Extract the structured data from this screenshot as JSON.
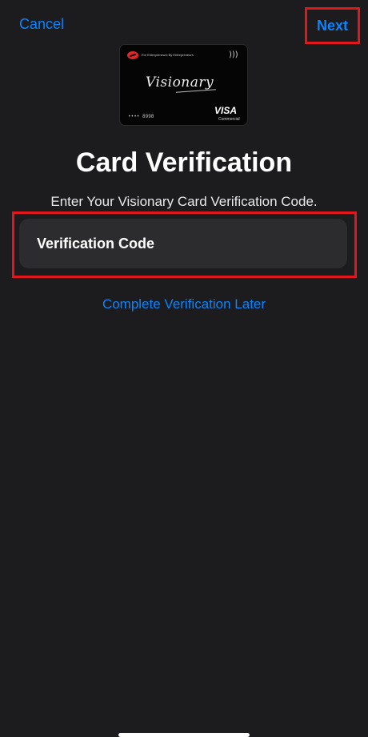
{
  "nav": {
    "cancel_label": "Cancel",
    "next_label": "Next"
  },
  "card": {
    "tagline": "For Entrepreneurs By Entrepreneurs",
    "script_name": "Visionary",
    "number_masked": "•••• 8998",
    "network": "VISA",
    "network_sub": "Commercial",
    "contactless_icon": "contactless-icon"
  },
  "page": {
    "title": "Card Verification",
    "subtitle": "Enter Your Visionary Card Verification Code."
  },
  "verification_field": {
    "placeholder": "Verification Code",
    "value": ""
  },
  "links": {
    "complete_later": "Complete Verification Later"
  },
  "colors": {
    "background": "#1c1c1e",
    "accent": "#0a84ff",
    "field_bg": "#2c2c2e",
    "highlight": "#e0181c"
  }
}
